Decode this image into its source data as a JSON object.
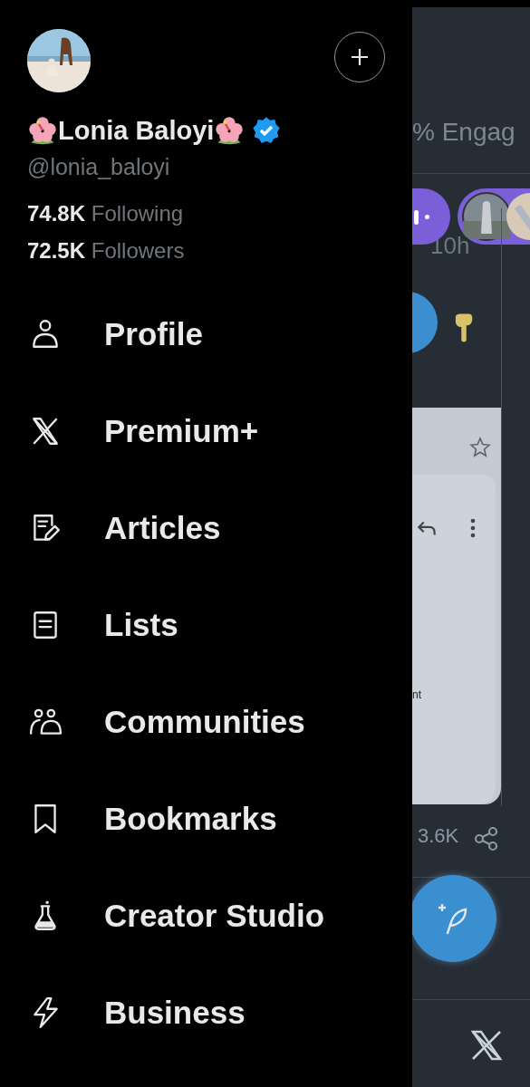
{
  "drawer": {
    "profile": {
      "name": "Lonia Baloyi",
      "handle": "@lonia_baloyi",
      "verified": true,
      "stats": [
        {
          "count": "74.8K",
          "label": "Following"
        },
        {
          "count": "72.5K",
          "label": "Followers"
        }
      ]
    },
    "menu": [
      {
        "label": "Profile",
        "kind": "profile"
      },
      {
        "label": "Premium+",
        "kind": "premium"
      },
      {
        "label": "Articles",
        "kind": "articles"
      },
      {
        "label": "Lists",
        "kind": "lists"
      },
      {
        "label": "Communities",
        "kind": "communities"
      },
      {
        "label": "Bookmarks",
        "kind": "bookmarks"
      },
      {
        "label": "Creator Studio",
        "kind": "studio"
      },
      {
        "label": "Business",
        "kind": "business"
      }
    ]
  },
  "background": {
    "engagement": "% Engag",
    "time": "10h",
    "fragment": "nt",
    "share_count": "3.6K"
  }
}
